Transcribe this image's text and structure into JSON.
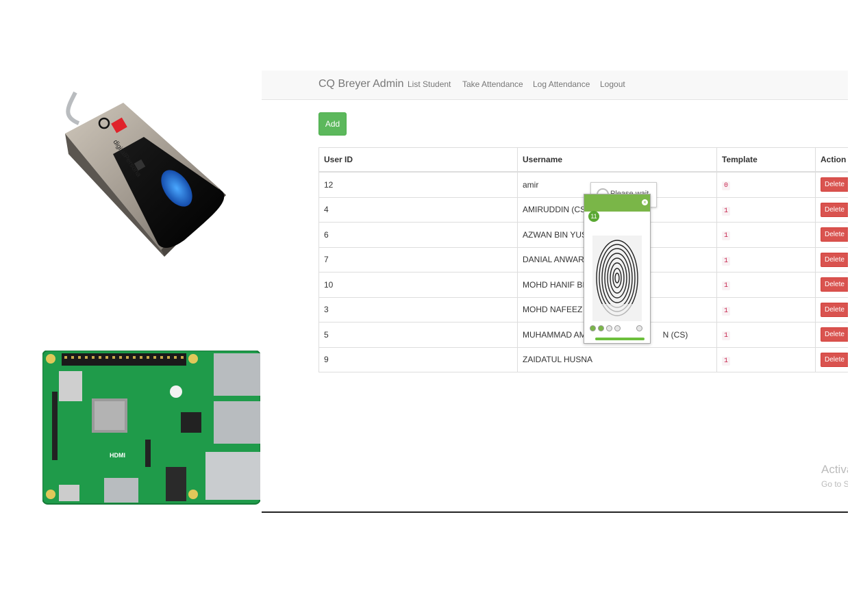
{
  "app": {
    "brand": "CQ Breyer Admin",
    "nav": [
      "List Student",
      "Take Attendance",
      "Log Attendance",
      "Logout"
    ],
    "add_label": "Add",
    "table": {
      "headers": [
        "User ID",
        "Username",
        "Template",
        "Action"
      ],
      "rows": [
        {
          "id": "12",
          "username": "amir",
          "template": "0",
          "action": "Delete"
        },
        {
          "id": "4",
          "username": "AMIRUDDIN (CS)",
          "template": "1",
          "action": "Delete"
        },
        {
          "id": "6",
          "username": "AZWAN BIN YUSC",
          "template": "1",
          "action": "Delete"
        },
        {
          "id": "7",
          "username": "DANIAL ANWAR (C",
          "template": "1",
          "action": "Delete"
        },
        {
          "id": "10",
          "username": "MOHD HANIF BIN",
          "template": "1",
          "action": "Delete"
        },
        {
          "id": "3",
          "username": "MOHD NAFEEZ N",
          "template": "1",
          "action": "Delete"
        },
        {
          "id": "5",
          "username": "MUHAMMAD AMIR",
          "username_tail": "N (CS)",
          "template": "1",
          "action": "Delete"
        },
        {
          "id": "9",
          "username": "ZAIDATUL HUSNA",
          "template": "1",
          "action": "Delete"
        }
      ]
    },
    "please_wait": "Please wait",
    "fingerprint_widget": {
      "count": "11",
      "dots_filled": 2,
      "dots_total": 4,
      "progress": 1.0,
      "accent": "#7ab648"
    },
    "watermark": {
      "line1": "Activa",
      "line2": "Go to Se"
    }
  },
  "photos": {
    "reader_logo": "digitalPersona",
    "rpi_labels": [
      "HDMI"
    ]
  },
  "colors": {
    "success": "#5cb85c",
    "danger": "#d9534f",
    "code_text": "#c7254e"
  }
}
